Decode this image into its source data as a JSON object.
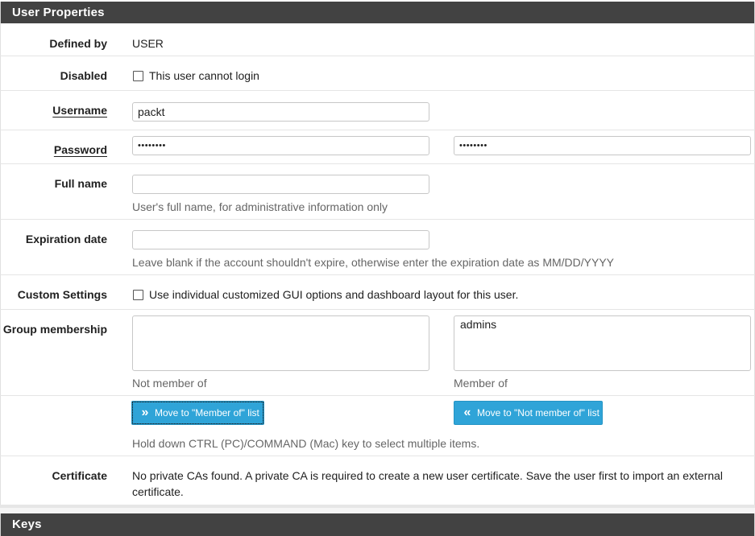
{
  "headings": {
    "user_properties": "User Properties",
    "keys": "Keys"
  },
  "defined_by": {
    "label": "Defined by",
    "value": "USER"
  },
  "disabled": {
    "label": "Disabled",
    "checkbox_label": "This user cannot login",
    "checked": false
  },
  "username": {
    "label": "Username",
    "value": "packt"
  },
  "password": {
    "label": "Password",
    "value": "••••••••",
    "confirm_value": "••••••••"
  },
  "full_name": {
    "label": "Full name",
    "value": "",
    "help": "User's full name, for administrative information only"
  },
  "expiration": {
    "label": "Expiration date",
    "value": "",
    "help": "Leave blank if the account shouldn't expire, otherwise enter the expiration date as MM/DD/YYYY"
  },
  "custom_settings": {
    "label": "Custom Settings",
    "checkbox_label": "Use individual customized GUI options and dashboard layout for this user.",
    "checked": false
  },
  "group_membership": {
    "label": "Group membership",
    "not_member_of": {
      "caption": "Not member of",
      "options": []
    },
    "member_of": {
      "caption": "Member of",
      "options": [
        "admins"
      ]
    },
    "move_to_member_label": "Move to \"Member of\" list",
    "move_to_not_member_label": "Move to \"Not member of\" list",
    "help": "Hold down CTRL (PC)/COMMAND (Mac) key to select multiple items."
  },
  "certificate": {
    "label": "Certificate",
    "text": "No private CAs found. A private CA is required to create a new user certificate. Save the user first to import an external certificate."
  },
  "colors": {
    "heading_bg": "#424242",
    "button_bg": "#2fa4d8",
    "help_text": "#666666"
  }
}
